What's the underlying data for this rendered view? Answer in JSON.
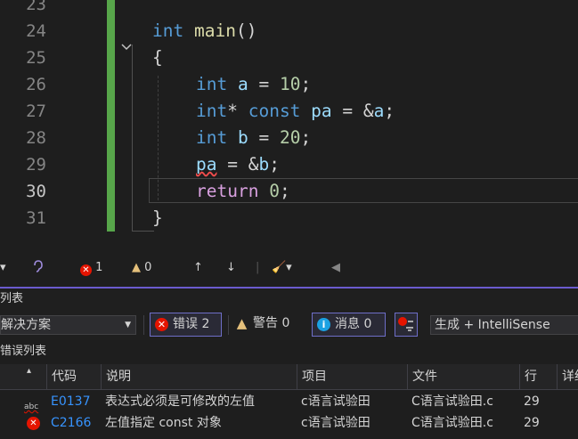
{
  "editor": {
    "lines": [
      {
        "num": "23"
      },
      {
        "num": "24"
      },
      {
        "num": "25"
      },
      {
        "num": "26"
      },
      {
        "num": "27"
      },
      {
        "num": "28"
      },
      {
        "num": "29"
      },
      {
        "num": "30"
      },
      {
        "num": "31"
      }
    ],
    "tokens": {
      "l24_int": "int",
      "l24_main": "main",
      "l24_paren": "()",
      "l25_brace": "{",
      "l26_int": "int",
      "l26_a": "a",
      "l26_eq": " = ",
      "l26_num": "10",
      "l26_semi": ";",
      "l27_int": "int",
      "l27_star": "* ",
      "l27_const": "const",
      "l27_pa": "pa",
      "l27_eq": " = &",
      "l27_a": "a",
      "l27_semi": ";",
      "l28_int": "int",
      "l28_b": "b",
      "l28_eq": " = ",
      "l28_num": "20",
      "l28_semi": ";",
      "l29_pa": "pa",
      "l29_eq": " = &",
      "l29_b": "b",
      "l29_semi": ";",
      "l30_return": "return",
      "l30_num": "0",
      "l30_semi": ";",
      "l31_brace": "}"
    }
  },
  "status": {
    "errors": "1",
    "warnings": "0"
  },
  "panel": {
    "title": "列表",
    "scope_dropdown": "解决方案",
    "errors_label": "错误 2",
    "warnings_label": "警告 0",
    "messages_label": "消息 0",
    "build_dropdown": "生成 + IntelliSense",
    "list_label": "错误列表"
  },
  "table": {
    "headers": {
      "code": "代码",
      "desc": "说明",
      "project": "项目",
      "file": "文件",
      "line": "行",
      "detail": "详细"
    },
    "rows": [
      {
        "code": "E0137",
        "desc": "表达式必须是可修改的左值",
        "project": "c语言试验田",
        "file": "C语言试验田.c",
        "line": "29",
        "kind": "intellisense"
      },
      {
        "code": "C2166",
        "desc": "左值指定 const 对象",
        "project": "c语言试验田",
        "file": "C语言试验田.c",
        "line": "29",
        "kind": "error"
      }
    ]
  },
  "colors": {
    "accent": "#6b5bce",
    "error": "#e51400",
    "keyword": "#569cd6",
    "function": "#dcdcaa",
    "variable": "#9cdcfe",
    "number": "#b5cea8",
    "control": "#d8a0df",
    "changebar": "#57a64a"
  }
}
